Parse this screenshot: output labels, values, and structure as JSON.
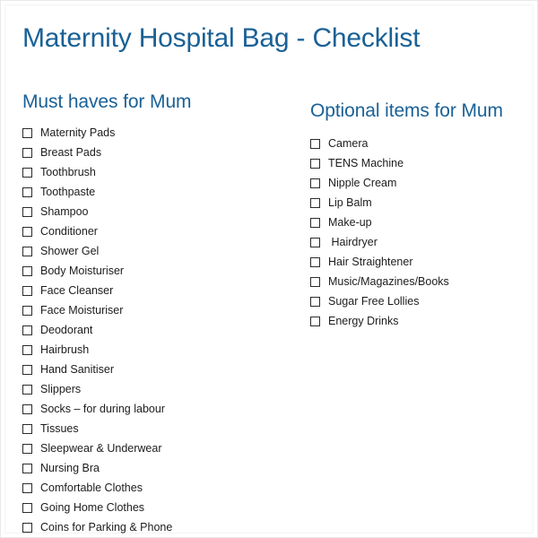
{
  "document": {
    "title": "Maternity Hospital Bag - Checklist",
    "heading_color": "#1a6196",
    "text_color": "#1c1c1c",
    "background_color": "#ffffff",
    "checkbox_border_color": "#2b2b2b"
  },
  "columns": [
    {
      "id": "must-haves-for-mum",
      "heading": "Must haves for Mum",
      "items": [
        {
          "label": "Maternity Pads",
          "checked": false
        },
        {
          "label": "Breast Pads",
          "checked": false
        },
        {
          "label": "Toothbrush",
          "checked": false
        },
        {
          "label": "Toothpaste",
          "checked": false
        },
        {
          "label": "Shampoo",
          "checked": false
        },
        {
          "label": "Conditioner",
          "checked": false
        },
        {
          "label": "Shower Gel",
          "checked": false
        },
        {
          "label": "Body Moisturiser",
          "checked": false
        },
        {
          "label": "Face Cleanser",
          "checked": false
        },
        {
          "label": "Face Moisturiser",
          "checked": false
        },
        {
          "label": "Deodorant",
          "checked": false
        },
        {
          "label": "Hairbrush",
          "checked": false
        },
        {
          "label": "Hand Sanitiser",
          "checked": false
        },
        {
          "label": "Slippers",
          "checked": false
        },
        {
          "label": "Socks – for during labour",
          "checked": false
        },
        {
          "label": "Tissues",
          "checked": false
        },
        {
          "label": "Sleepwear & Underwear",
          "checked": false
        },
        {
          "label": "Nursing Bra",
          "checked": false
        },
        {
          "label": "Comfortable Clothes",
          "checked": false
        },
        {
          "label": "Going Home Clothes",
          "checked": false
        },
        {
          "label": "Coins for Parking & Phone",
          "checked": false
        }
      ]
    },
    {
      "id": "optional-items-for-mum",
      "heading": "Optional items for Mum",
      "items": [
        {
          "label": "Camera",
          "checked": false
        },
        {
          "label": "TENS Machine",
          "checked": false
        },
        {
          "label": "Nipple Cream",
          "checked": false
        },
        {
          "label": "Lip Balm",
          "checked": false
        },
        {
          "label": "Make-up",
          "checked": false
        },
        {
          "label": " Hairdryer",
          "checked": false
        },
        {
          "label": "Hair Straightener",
          "checked": false
        },
        {
          "label": "Music/Magazines/Books",
          "checked": false
        },
        {
          "label": "Sugar Free Lollies",
          "checked": false
        },
        {
          "label": "Energy Drinks",
          "checked": false
        }
      ]
    }
  ]
}
